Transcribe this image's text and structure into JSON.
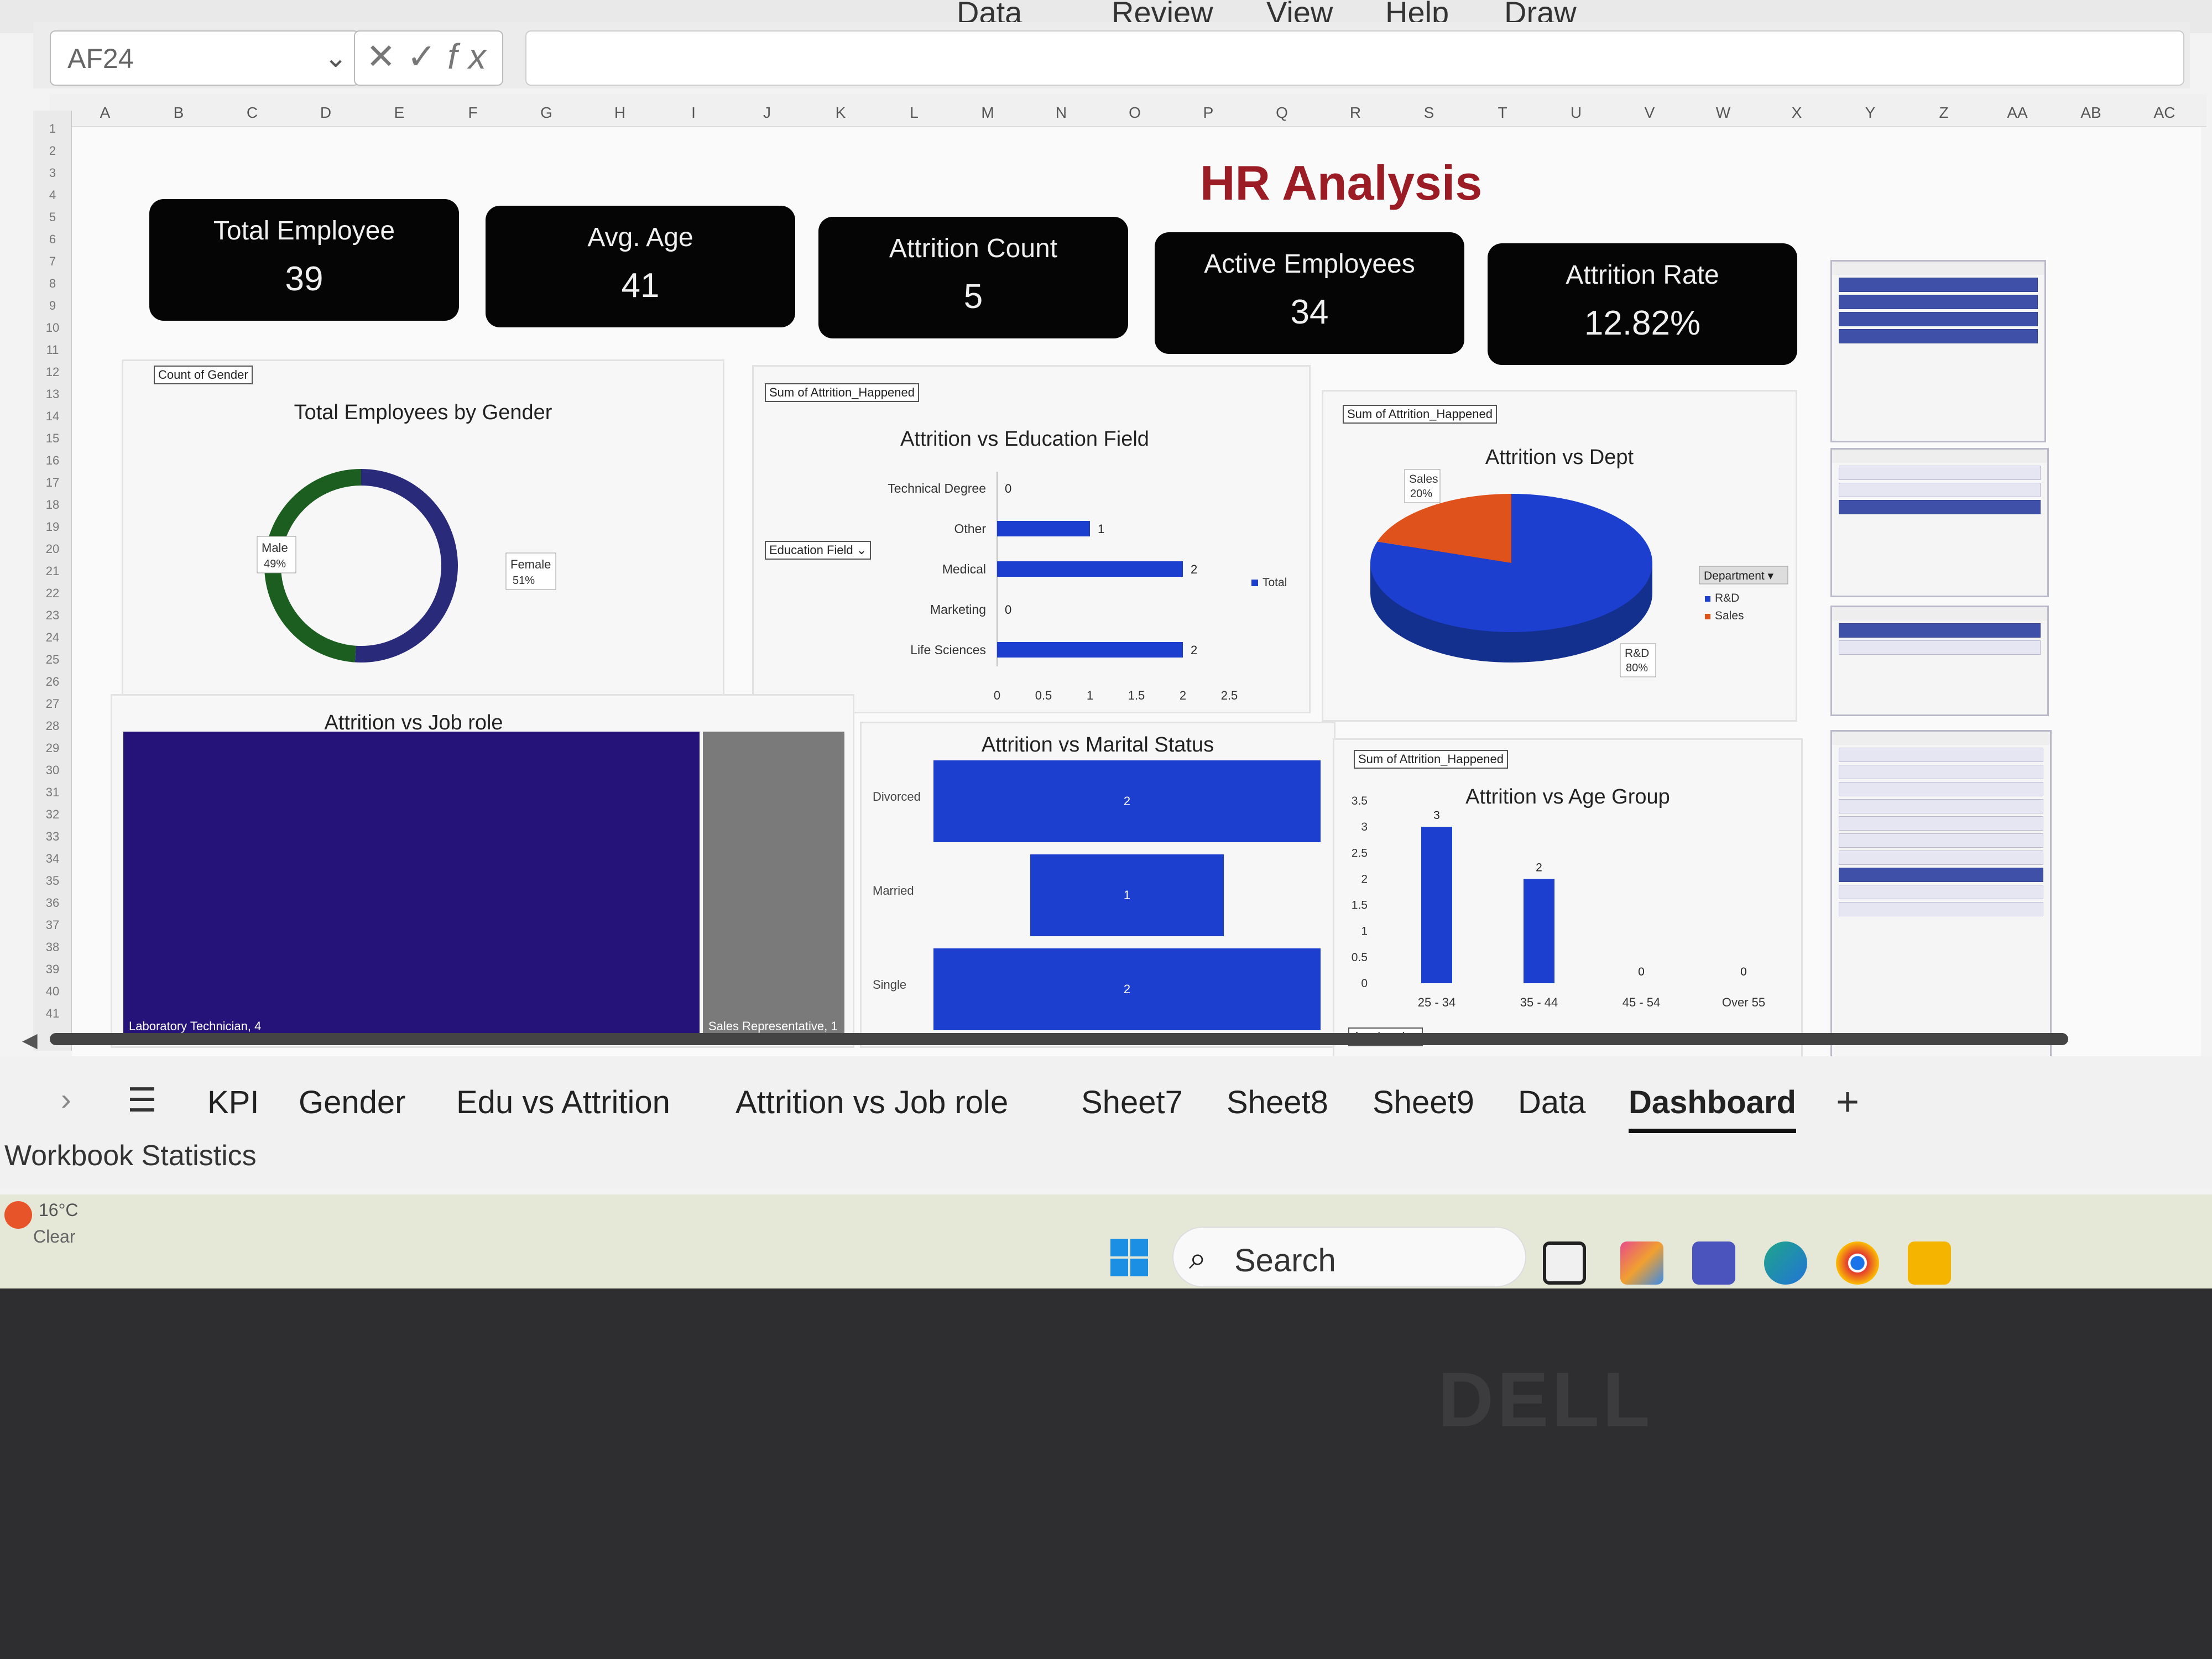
{
  "ribbon": {
    "menu": [
      "Data",
      "Review",
      "View",
      "Help",
      "Draw"
    ]
  },
  "formula_bar": {
    "name_box": "AF24",
    "fx_icon": "fx",
    "value": ""
  },
  "columns": [
    "A",
    "B",
    "C",
    "D",
    "E",
    "F",
    "G",
    "H",
    "I",
    "J",
    "K",
    "L",
    "M",
    "N",
    "O",
    "P",
    "Q",
    "R",
    "S",
    "T",
    "U",
    "V",
    "W",
    "X",
    "Y",
    "Z",
    "AA",
    "AB",
    "AC"
  ],
  "rows": [
    "1",
    "2",
    "3",
    "4",
    "5",
    "6",
    "7",
    "8",
    "9",
    "10",
    "11",
    "12",
    "13",
    "14",
    "15",
    "16",
    "17",
    "18",
    "19",
    "20",
    "21",
    "22",
    "23",
    "24",
    "25",
    "26",
    "27",
    "28",
    "29",
    "30",
    "31",
    "32",
    "33",
    "34",
    "35",
    "36",
    "37",
    "38",
    "39",
    "40",
    "41"
  ],
  "dashboard": {
    "title": "HR Analysis",
    "kpis": [
      {
        "label": "Total Employee",
        "value": "39"
      },
      {
        "label": "Avg. Age",
        "value": "41"
      },
      {
        "label": "Attrition Count",
        "value": "5"
      },
      {
        "label": "Active Employees",
        "value": "34"
      },
      {
        "label": "Attrition Rate",
        "value": "12.82%"
      }
    ]
  },
  "charts": {
    "gender": {
      "field_tag": "Count of Gender",
      "title": "Total Employees by Gender"
    },
    "education": {
      "field_tag": "Sum of Attrition_Happened",
      "title": "Attrition vs Education Field",
      "filter": "Education Field",
      "legend": "Total"
    },
    "dept": {
      "field_tag": "Sum of Attrition_Happened",
      "title": "Attrition vs Dept",
      "legend_title": "Department",
      "legend": [
        "R&D",
        "Sales"
      ]
    },
    "jobrole": {
      "title": "Attrition vs Job role"
    },
    "marital": {
      "title": "Attrition vs Marital Status"
    },
    "age": {
      "field_tag": "Sum of Attrition_Happened",
      "title": "Attrition vs Age Group",
      "filter": "Age band"
    }
  },
  "chart_data": [
    {
      "type": "pie",
      "variant": "doughnut",
      "title": "Total Employees by Gender",
      "labels": [
        "Male",
        "Female"
      ],
      "values": [
        49,
        51
      ],
      "value_labels": [
        "49%",
        "51%"
      ],
      "colors": [
        "#1b5e20",
        "#2a2a7a"
      ]
    },
    {
      "type": "bar",
      "orientation": "horizontal",
      "title": "Attrition vs Education Field",
      "categories": [
        "Technical Degree",
        "Other",
        "Medical",
        "Marketing",
        "Life Sciences"
      ],
      "series": [
        {
          "name": "Total",
          "values": [
            0,
            1,
            2,
            0,
            2
          ]
        }
      ],
      "xticks": [
        "0",
        "0.5",
        "1",
        "1.5",
        "2",
        "2.5"
      ],
      "xlim": [
        0,
        2.5
      ],
      "color": "#1c3fd0"
    },
    {
      "type": "pie",
      "title": "Attrition vs Dept",
      "labels": [
        "R&D",
        "Sales"
      ],
      "values": [
        80,
        20
      ],
      "value_labels": [
        "80%",
        "20%"
      ],
      "colors": [
        "#1c3fd0",
        "#e0521b"
      ],
      "legend": "right"
    },
    {
      "type": "treemap",
      "title": "Attrition vs Job role",
      "labels": [
        "Laboratory Technician",
        "Sales Representative"
      ],
      "values": [
        4,
        1
      ],
      "colors": [
        "#25137a",
        "#7a7a7a"
      ]
    },
    {
      "type": "bar",
      "orientation": "horizontal",
      "title": "Attrition vs Marital Status",
      "categories": [
        "Divorced",
        "Married",
        "Single"
      ],
      "values": [
        2,
        1,
        2
      ],
      "color": "#1c3fd0"
    },
    {
      "type": "bar",
      "title": "Attrition vs Age Group",
      "categories": [
        "25 - 34",
        "35 - 44",
        "45 - 54",
        "Over 55"
      ],
      "values": [
        3,
        2,
        0,
        0
      ],
      "yticks": [
        "0",
        "0.5",
        "1",
        "1.5",
        "2",
        "2.5",
        "3",
        "3.5"
      ],
      "ylim": [
        0,
        3.5
      ],
      "color": "#1c3fd0"
    }
  ],
  "sheet_tabs": [
    "KPI",
    "Gender",
    "Edu vs Attrition",
    "Attrition vs Job role",
    "Sheet7",
    "Sheet8",
    "Sheet9",
    "Data",
    "Dashboard"
  ],
  "active_tab": "Dashboard",
  "status_bar": {
    "text": "Workbook Statistics"
  },
  "taskbar": {
    "weather_temp": "16°C",
    "weather_condition": "Clear",
    "search_placeholder": "Search"
  },
  "device_logo": "DELL"
}
